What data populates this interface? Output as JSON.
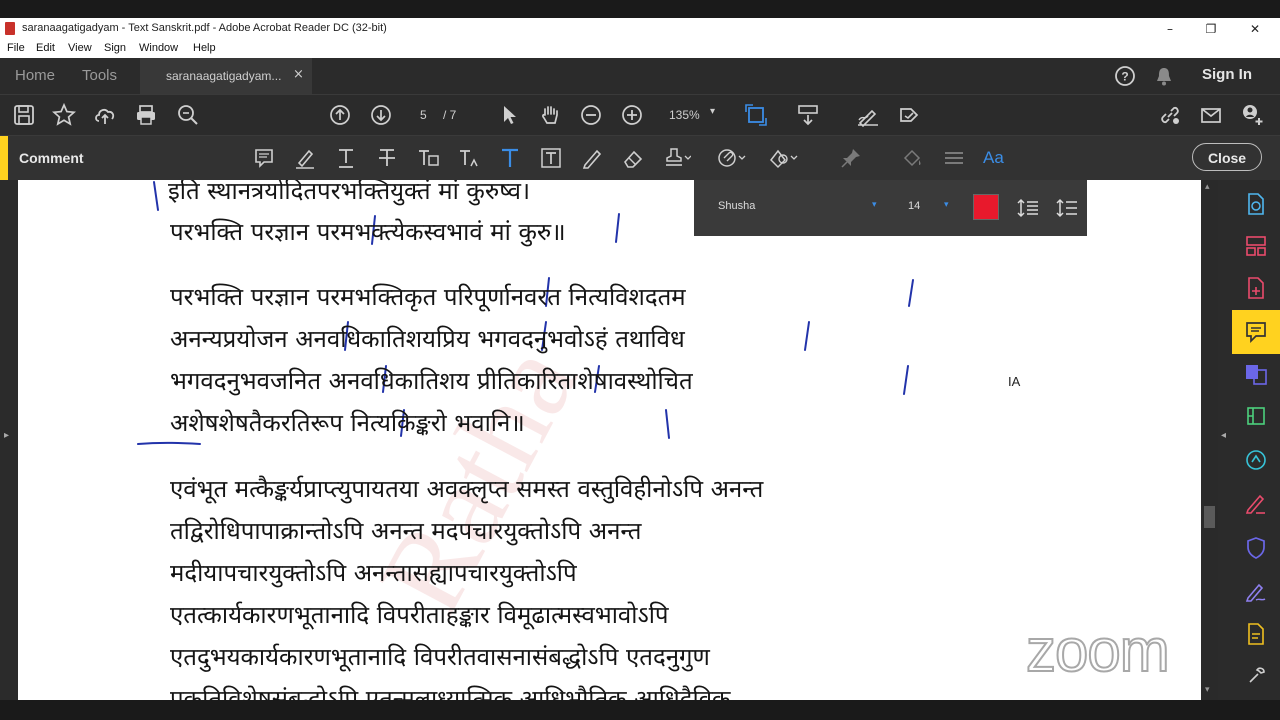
{
  "window": {
    "title": "saranaagatigadyam - Text Sanskrit.pdf - Adobe Acrobat Reader DC (32-bit)",
    "minimize": "–",
    "restore": "❐",
    "close": "✕"
  },
  "menu": [
    "File",
    "Edit",
    "View",
    "Sign",
    "Window",
    "Help"
  ],
  "tabs": {
    "home": "Home",
    "tools": "Tools",
    "document": "saranaagatigadyam...",
    "close_glyph": "×"
  },
  "account": {
    "sign_in": "Sign In"
  },
  "toolbar": {
    "page_current": "5",
    "page_total": "/ 7",
    "zoom": "135%"
  },
  "comment_bar": {
    "label": "Comment",
    "close": "Close",
    "text_props": "Aa"
  },
  "font_panel": {
    "font": "Shusha",
    "size": "14",
    "color": "#e8192c"
  },
  "document": {
    "lines": [
      "इति स्थानत्रयोदितपरभक्तियुक्तं मां कुरुष्व।",
      "परभक्ति परज्ञान परमभक्त्येकस्वभावं मां कुरु॥",
      "परभक्ति परज्ञान परमभक्तिकृत परिपूर्णानवरत नित्यविशदतम",
      "अनन्यप्रयोजन अनवधिकातिशयप्रिय भगवदनुभवोऽहं तथाविध",
      "भगवदनुभवजनित अनवधिकातिशय प्रीतिकारिताशेषावस्थोचित",
      "अशेषशेषतैकरतिरूप नित्यकिङ्करो भवानि॥",
      "एवंभूत मत्कैङ्कर्यप्राप्त्युपायतया अवक्लृप्त समस्त वस्तुविहीनोऽपि अनन्त",
      "तद्विरोधिपापाक्रान्तोऽपि अनन्त मदपचारयुक्तोऽपि अनन्त",
      "मदीयापचारयुक्तोऽपि अनन्तासह्यापचारयुक्तोऽपि",
      "एतत्कार्यकारणभूतानादि विपरीताहङ्कार विमूढात्मस्वभावोऽपि",
      "एतदुभयकार्यकारणभूतानादि विपरीतवासनासंबद्धोऽपि एतदनुगुण",
      "प्रकृतिविशेषसंबद्धोऽपि एतन्मूलाध्यात्मिक आधिभौतिक आधिदैविक"
    ],
    "cursor_label": "A"
  },
  "watermark": "Ratha",
  "overlay": "zoom",
  "colors": {
    "accent": "#ffd21f",
    "annotation": "#2233aa",
    "ink_star": "#222222"
  }
}
